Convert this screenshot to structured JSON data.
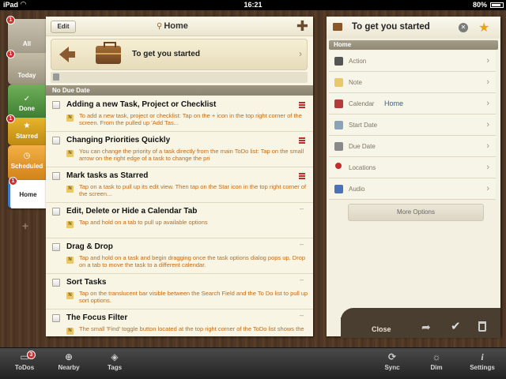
{
  "status": {
    "carrier": "iPad",
    "time": "16:21",
    "battery": "80%"
  },
  "tabs": {
    "all": {
      "label": "All",
      "badge": "1"
    },
    "today": {
      "label": "Today",
      "badge": "1"
    },
    "done": {
      "label": "Done"
    },
    "starred": {
      "label": "Starred",
      "badge": "1"
    },
    "scheduled": {
      "label": "Scheduled"
    },
    "home": {
      "label": "Home",
      "badge": "1"
    }
  },
  "main": {
    "edit_label": "Edit",
    "title": "Home",
    "project_title": "To get you started",
    "section": "No Due Date",
    "tasks": [
      {
        "title": "Adding a new Task, Project or Checklist",
        "note": "To add a new task, project or checklist: Tap on the + icon in the top right corner of the screen. From the pulled up 'Add Tas...",
        "priority": "high"
      },
      {
        "title": "Changing Priorities Quickly",
        "note": "You can change the priority of a task directly from the main ToDo list: Tap on the small arrow on the right edge of a task to change the pri",
        "priority": "high"
      },
      {
        "title": "Mark tasks as Starred",
        "note": "Tap on a task to pull up its edit view. Then tap on the Star icon in the top right corner of the screen...",
        "priority": "high"
      },
      {
        "title": "Edit, Delete or Hide a Calendar Tab",
        "note": "Tap and hold on a tab to pull up available options",
        "priority": "none"
      },
      {
        "title": "Drag & Drop",
        "note": "Tap and hold on a task and begin dragging once the task options dialog pops up. Drop on a tab to move the task to a different calendar.",
        "priority": "none"
      },
      {
        "title": "Sort Tasks",
        "note": "Tap on the translucent bar visible between the Search Field and the To Do list to pull up sort options.",
        "priority": "none"
      },
      {
        "title": "The Focus Filter",
        "note": "The small 'Find' toggle button located at the top right corner of the ToDo list shows the",
        "priority": "none"
      }
    ]
  },
  "detail": {
    "title": "To get you started",
    "tag": "Home",
    "rows": [
      {
        "label": "Action",
        "value": ""
      },
      {
        "label": "Note",
        "value": ""
      },
      {
        "label": "Calendar",
        "value": "Home"
      },
      {
        "label": "Start Date",
        "value": ""
      },
      {
        "label": "Due Date",
        "value": ""
      },
      {
        "label": "Locations",
        "value": ""
      },
      {
        "label": "Audio",
        "value": ""
      }
    ],
    "more_label": "More Options",
    "close_label": "Close"
  },
  "toolbar": {
    "todos": "ToDos",
    "todos_badge": "3",
    "nearby": "Nearby",
    "tags": "Tags",
    "sync": "Sync",
    "dim": "Dim",
    "settings": "Settings"
  },
  "colors": {
    "note_text": "#c46a12",
    "priority": "#c62b2b",
    "accent_blue": "#3e7acb",
    "star": "#e8a21a"
  }
}
